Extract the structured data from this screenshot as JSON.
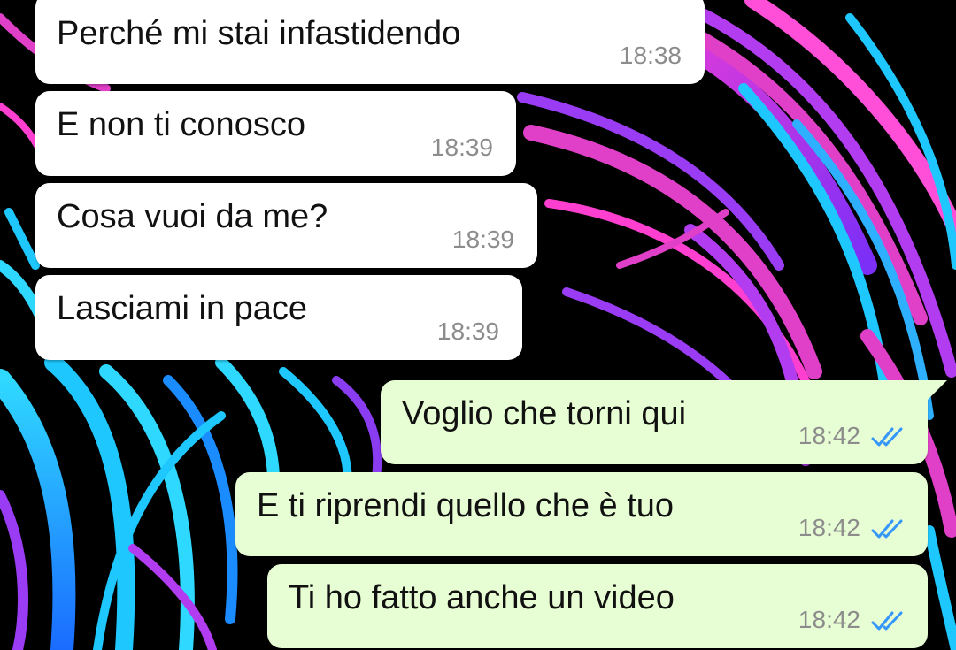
{
  "colors": {
    "incoming_bubble": "#ffffff",
    "outgoing_bubble": "#e7fdd3",
    "tick_read": "#3497f9",
    "timestamp": "#8c8c8c",
    "wallpaper_magenta": "#e040c8",
    "wallpaper_cyan": "#1ec8ff",
    "wallpaper_purple": "#8a3cf0"
  },
  "messages": [
    {
      "direction": "incoming",
      "text": "Perché mi stai infastidendo",
      "time": "18:38"
    },
    {
      "direction": "incoming",
      "text": "E non ti conosco",
      "time": "18:39"
    },
    {
      "direction": "incoming",
      "text": "Cosa vuoi da me?",
      "time": "18:39"
    },
    {
      "direction": "incoming",
      "text": "Lasciami in pace",
      "time": "18:39"
    },
    {
      "direction": "outgoing",
      "text": "Voglio che torni qui",
      "time": "18:42",
      "status_icon": "double-check-read-icon"
    },
    {
      "direction": "outgoing",
      "text": "E ti riprendi quello che è tuo",
      "time": "18:42",
      "status_icon": "double-check-read-icon"
    },
    {
      "direction": "outgoing",
      "text": "Ti ho fatto anche un video",
      "time": "18:42",
      "status_icon": "double-check-read-icon"
    }
  ]
}
